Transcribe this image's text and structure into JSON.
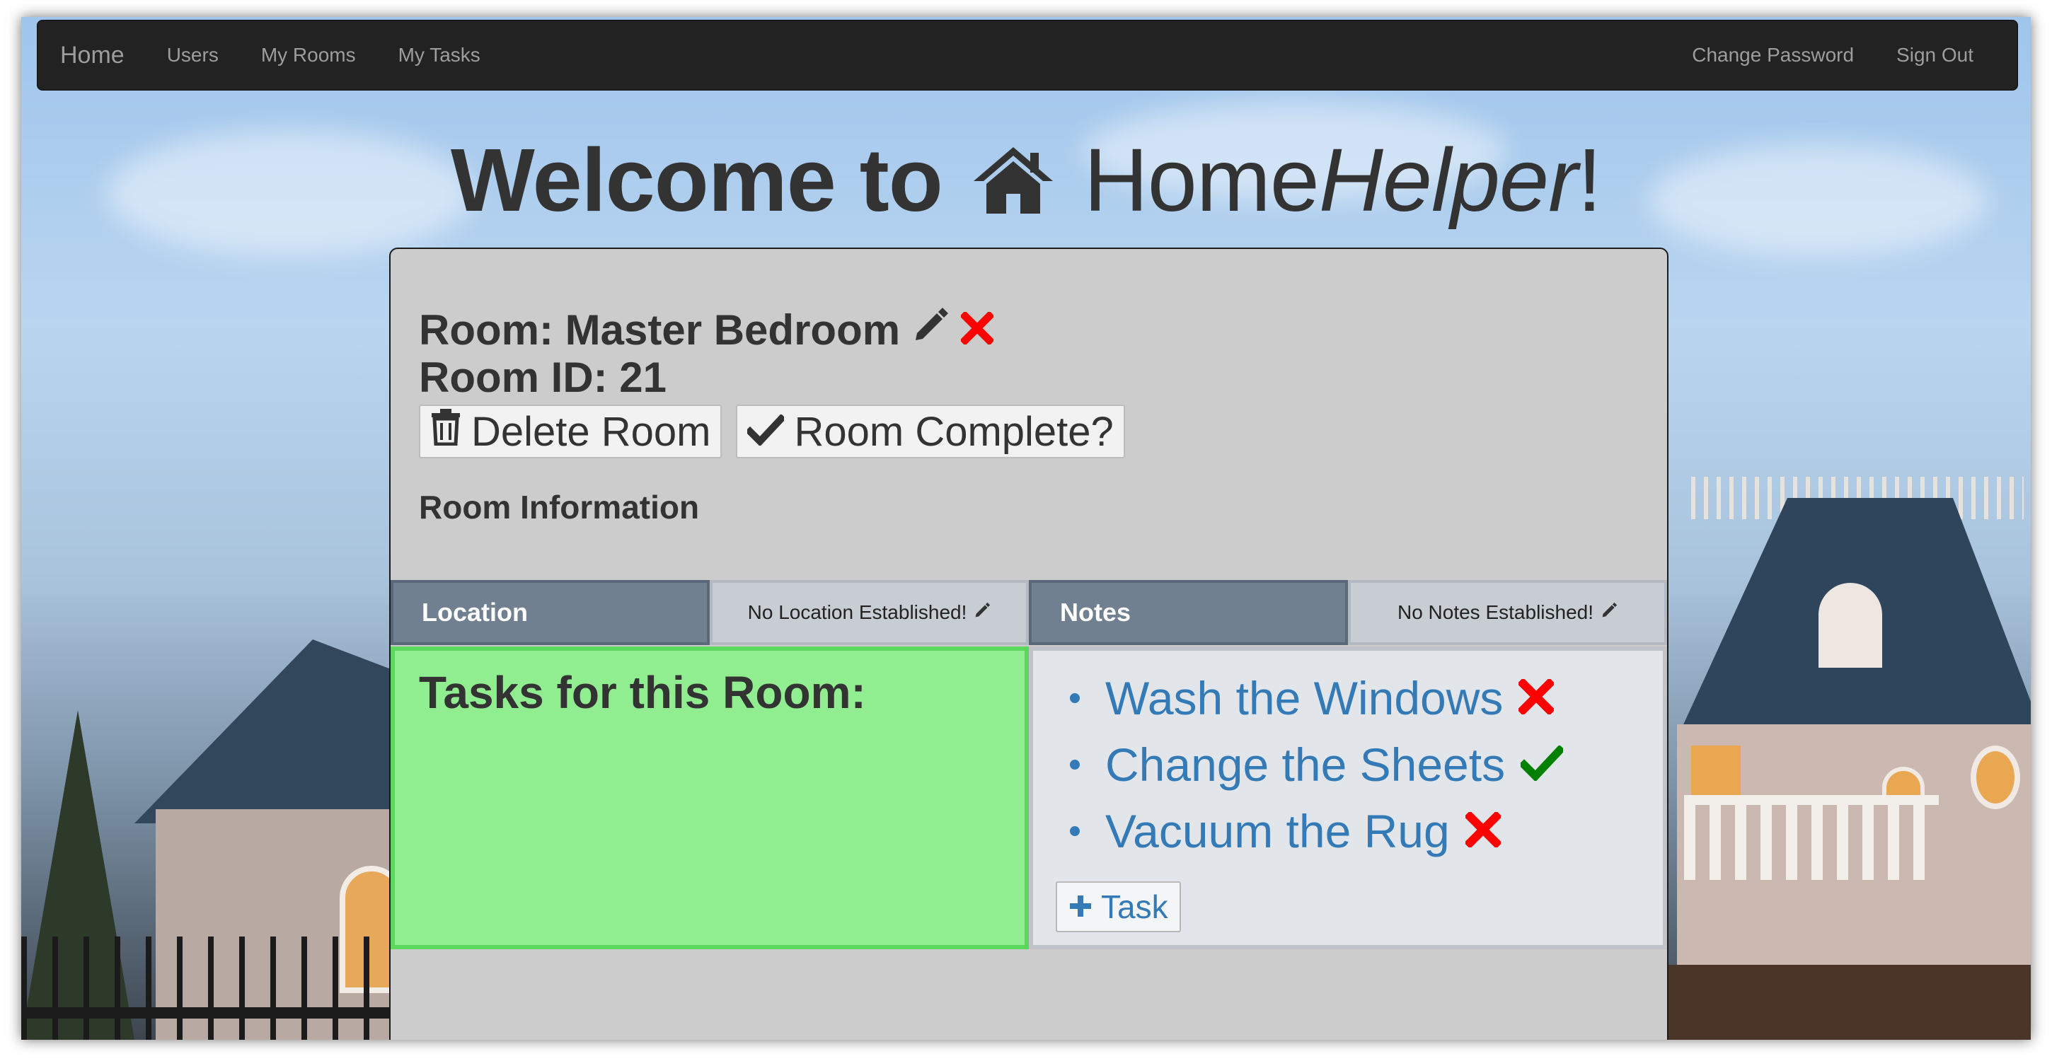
{
  "navbar": {
    "brand": "Home",
    "links_left": [
      "Users",
      "My Rooms",
      "My Tasks"
    ],
    "links_right": [
      "Change Password",
      "Sign Out"
    ]
  },
  "heading": {
    "prefix": "Welcome to",
    "brand_regular": "Home",
    "brand_italic": "Helper",
    "suffix": "!",
    "icon": "home-icon"
  },
  "room": {
    "title": "Room: Master Bedroom",
    "id_label": "Room ID: 21",
    "delete_label": "Delete Room",
    "complete_label": "Room Complete?",
    "info_heading": "Room Information",
    "location_label": "Location",
    "location_value": "No Location Established!",
    "notes_label": "Notes",
    "notes_value": "No Notes Established!",
    "tasks_heading": "Tasks for this Room:",
    "tasks": [
      {
        "name": "Wash the Windows",
        "status": "incomplete"
      },
      {
        "name": "Change the Sheets",
        "status": "complete"
      },
      {
        "name": "Vacuum the Rug",
        "status": "incomplete"
      }
    ],
    "add_task_label": "Task"
  },
  "colors": {
    "navbar_bg": "#222222",
    "panel_bg": "#cccccc",
    "info_head_bg": "#708090",
    "tasks_left_bg": "#90ee90",
    "link_blue": "#337ab7",
    "delete_red": "#ff0000",
    "check_green": "#008000"
  }
}
